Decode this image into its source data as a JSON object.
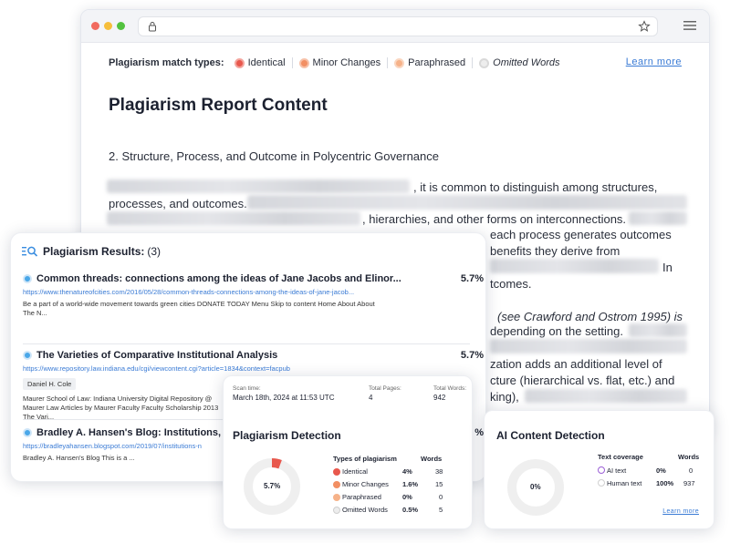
{
  "legend": {
    "title": "Plagiarism match types:",
    "items": [
      {
        "label": "Identical",
        "fill": "#e8584d",
        "ring": "#f4a59e"
      },
      {
        "label": "Minor Changes",
        "fill": "#f28f63",
        "ring": "#f7c1a8"
      },
      {
        "label": "Paraphrased",
        "fill": "#f6b289",
        "ring": "#fad6c0"
      },
      {
        "label": "Omitted Words",
        "fill": "#ededed",
        "ring": "#d9d9d9"
      }
    ],
    "learn_more": "Learn more"
  },
  "report": {
    "title": "Plagiarism Report Content",
    "section_heading": "2. Structure, Process, and Outcome in Polycentric Governance",
    "lines": [
      ", it is common to distinguish among structures,",
      "processes, and outcomes.",
      ", hierarchies, and other forms on interconnections.",
      "each process generates outcomes",
      "benefits they derive from",
      "In",
      "tcomes.",
      "(see Crawford and Ostrom 1995) is",
      "depending on the setting.",
      "zation adds an additional level of",
      "cture (hierarchical vs. flat, etc.) and",
      "king),"
    ]
  },
  "results": {
    "title": "Plagiarism Results:",
    "count": "(3)",
    "items": [
      {
        "title": "Common threads: connections among the ideas of Jane Jacobs and Elinor...",
        "percent": "5.7%",
        "url": "https://www.thenatureofcities.com/2016/05/28/common-threads-connections-among-the-ideas-of-jane-jacob...",
        "snippet": "Be a part of a world-wide movement towards green cities DONATE TODAY Menu Skip to content Home About About The N..."
      },
      {
        "title": "The Varieties of Comparative Institutional Analysis",
        "percent": "5.7%",
        "url": "https://www.repository.law.indiana.edu/cgi/viewcontent.cgi?article=1834&context=facpub",
        "author": "Daniel H. Cole",
        "snippet": "Maurer School of Law: Indiana University Digital Repository @ Maurer Law Articles by Maurer Faculty Faculty Scholarship 2013 The Vari..."
      },
      {
        "title": "Bradley A. Hansen's Blog: Institutions, N",
        "percent": "%",
        "url": "https://bradleyahansen.blogspot.com/2019/07/institutions-n",
        "snippet": "Bradley A. Hansen's Blog This is a ..."
      }
    ]
  },
  "scan": {
    "scan_time_label": "Scan time:",
    "scan_time": "March 18th, 2024 at 11:53 UTC",
    "pages_label": "Total Pages:",
    "pages": "4",
    "words_label": "Total Words:",
    "words": "942"
  },
  "plagiarism_detection": {
    "title": "Plagiarism Detection",
    "total_percent": "5.7%",
    "total_fraction": 0.057,
    "col_type": "Types of plagiarism",
    "col_words": "Words",
    "rows": [
      {
        "label": "Identical",
        "percent": "4%",
        "words": "38",
        "color": "#e8584d"
      },
      {
        "label": "Minor Changes",
        "percent": "1.6%",
        "words": "15",
        "color": "#f28f63"
      },
      {
        "label": "Paraphrased",
        "percent": "0%",
        "words": "0",
        "color": "#f6b289"
      },
      {
        "label": "Omitted Words",
        "percent": "0.5%",
        "words": "5",
        "color": "#ededed"
      }
    ]
  },
  "ai_detection": {
    "title": "AI Content Detection",
    "total_percent": "0%",
    "col_type": "Text coverage",
    "col_words": "Words",
    "rows": [
      {
        "label": "AI text",
        "percent": "0%",
        "words": "0",
        "color": "#9b5fd6"
      },
      {
        "label": "Human text",
        "percent": "100%",
        "words": "937",
        "color": "#ededed"
      }
    ],
    "learn_more": "Learn more"
  }
}
